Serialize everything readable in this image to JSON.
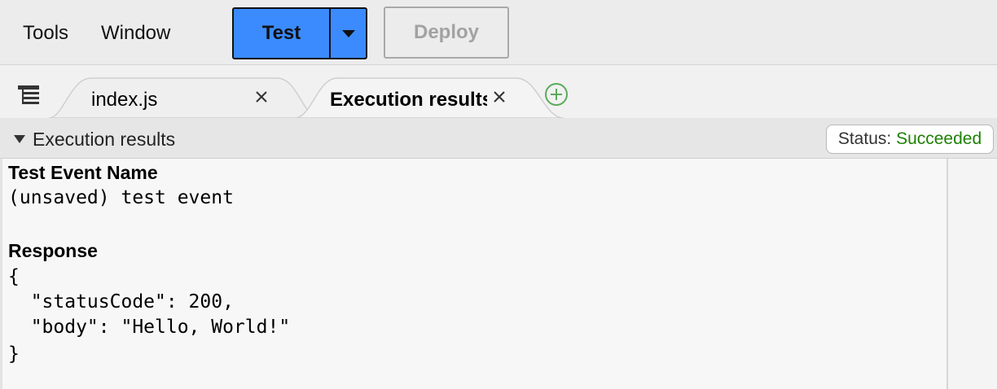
{
  "menu": {
    "tools": "Tools",
    "window": "Window"
  },
  "toolbar": {
    "test_label": "Test",
    "deploy_label": "Deploy"
  },
  "tabs": [
    {
      "label": "index.js",
      "active": false
    },
    {
      "label": "Execution results",
      "active": true
    }
  ],
  "results": {
    "title": "Execution results",
    "status_label": "Status:",
    "status_value": "Succeeded",
    "status_color": "#1d8102",
    "test_event_heading": "Test Event Name",
    "test_event_value": "(unsaved) test event",
    "response_heading": "Response",
    "response_lines": [
      "{",
      "  \"statusCode\": 200,",
      "  \"body\": \"Hello, World!\"",
      "}"
    ]
  },
  "colors": {
    "test_button": "#3b8bff",
    "add_tab": "#5aab5a"
  },
  "icons": {
    "tab_menu": "list-menu-icon",
    "close": "close-icon",
    "add": "plus-circle-icon",
    "dropdown": "caret-down-icon",
    "collapse": "triangle-down-icon"
  }
}
